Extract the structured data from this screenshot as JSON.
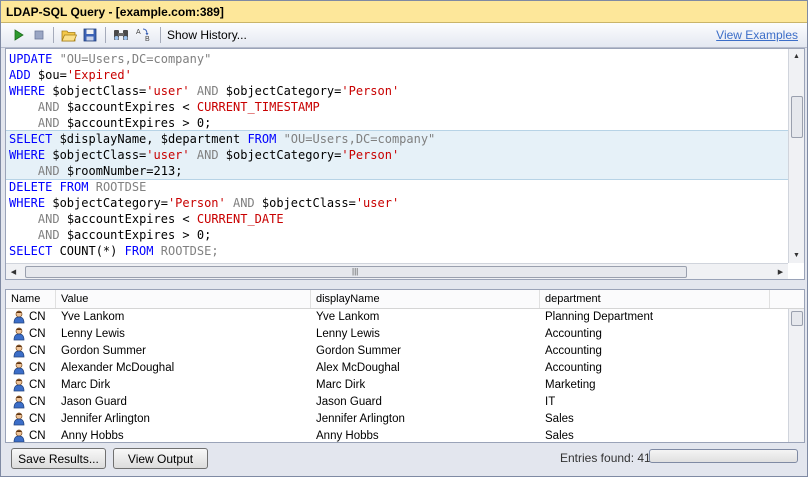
{
  "window": {
    "title": "LDAP-SQL Query - [example.com:389]"
  },
  "toolbar": {
    "icons": [
      "run-icon",
      "stop-icon",
      "open-folder-icon",
      "save-icon",
      "find-icon",
      "replace-icon"
    ],
    "show_history_label": "Show History...",
    "view_examples_label": "View Examples"
  },
  "editor": {
    "lines": [
      {
        "highlight": false,
        "tokens": [
          {
            "t": "kw",
            "v": "UPDATE"
          },
          {
            "t": "lit",
            "v": " \"OU=Users,DC=company\""
          }
        ]
      },
      {
        "highlight": false,
        "tokens": [
          {
            "t": "kw",
            "v": "ADD"
          },
          {
            "t": "plain",
            "v": " $ou="
          },
          {
            "t": "str",
            "v": "'Expired'"
          }
        ]
      },
      {
        "highlight": false,
        "tokens": [
          {
            "t": "kw",
            "v": "WHERE"
          },
          {
            "t": "plain",
            "v": " $objectClass="
          },
          {
            "t": "str",
            "v": "'user'"
          },
          {
            "t": "plain",
            "v": " "
          },
          {
            "t": "lit",
            "v": "AND"
          },
          {
            "t": "plain",
            "v": " $objectCategory="
          },
          {
            "t": "str",
            "v": "'Person'"
          }
        ]
      },
      {
        "highlight": false,
        "tokens": [
          {
            "t": "plain",
            "v": "    "
          },
          {
            "t": "lit",
            "v": "AND"
          },
          {
            "t": "plain",
            "v": " $accountExpires < "
          },
          {
            "t": "str",
            "v": "CURRENT_TIMESTAMP"
          }
        ]
      },
      {
        "highlight": false,
        "tokens": [
          {
            "t": "plain",
            "v": "    "
          },
          {
            "t": "lit",
            "v": "AND"
          },
          {
            "t": "plain",
            "v": " $accountExpires > 0;"
          }
        ]
      },
      {
        "highlight": true,
        "tokens": [
          {
            "t": "kw",
            "v": "SELECT"
          },
          {
            "t": "plain",
            "v": " $displayName, $department "
          },
          {
            "t": "kw",
            "v": "FROM"
          },
          {
            "t": "lit",
            "v": " \"OU=Users,DC=company\""
          }
        ]
      },
      {
        "highlight": true,
        "tokens": [
          {
            "t": "kw",
            "v": "WHERE"
          },
          {
            "t": "plain",
            "v": " $objectClass="
          },
          {
            "t": "str",
            "v": "'user'"
          },
          {
            "t": "plain",
            "v": " "
          },
          {
            "t": "lit",
            "v": "AND"
          },
          {
            "t": "plain",
            "v": " $objectCategory="
          },
          {
            "t": "str",
            "v": "'Person'"
          }
        ]
      },
      {
        "highlight": true,
        "tokens": [
          {
            "t": "plain",
            "v": "    "
          },
          {
            "t": "lit",
            "v": "AND"
          },
          {
            "t": "plain",
            "v": " $roomNumber=213;"
          }
        ]
      },
      {
        "highlight": false,
        "tokens": [
          {
            "t": "kw",
            "v": "DELETE"
          },
          {
            "t": "plain",
            "v": " "
          },
          {
            "t": "kw",
            "v": "FROM"
          },
          {
            "t": "lit",
            "v": " ROOTDSE"
          }
        ]
      },
      {
        "highlight": false,
        "tokens": [
          {
            "t": "kw",
            "v": "WHERE"
          },
          {
            "t": "plain",
            "v": " $objectCategory="
          },
          {
            "t": "str",
            "v": "'Person'"
          },
          {
            "t": "plain",
            "v": " "
          },
          {
            "t": "lit",
            "v": "AND"
          },
          {
            "t": "plain",
            "v": " $objectClass="
          },
          {
            "t": "str",
            "v": "'user'"
          }
        ]
      },
      {
        "highlight": false,
        "tokens": [
          {
            "t": "plain",
            "v": "    "
          },
          {
            "t": "lit",
            "v": "AND"
          },
          {
            "t": "plain",
            "v": " $accountExpires < "
          },
          {
            "t": "str",
            "v": "CURRENT_DATE"
          }
        ]
      },
      {
        "highlight": false,
        "tokens": [
          {
            "t": "plain",
            "v": "    "
          },
          {
            "t": "lit",
            "v": "AND"
          },
          {
            "t": "plain",
            "v": " $accountExpires > 0;"
          }
        ]
      },
      {
        "highlight": false,
        "tokens": [
          {
            "t": "kw",
            "v": "SELECT"
          },
          {
            "t": "plain",
            "v": " COUNT(*) "
          },
          {
            "t": "kw",
            "v": "FROM"
          },
          {
            "t": "lit",
            "v": " ROOTDSE;"
          }
        ]
      }
    ]
  },
  "results": {
    "columns": [
      "Name",
      "Value",
      "displayName",
      "department"
    ],
    "rows": [
      [
        "CN",
        "Yve Lankom",
        "Yve Lankom",
        "Planning Department"
      ],
      [
        "CN",
        "Lenny Lewis",
        "Lenny Lewis",
        "Accounting"
      ],
      [
        "CN",
        "Gordon Summer",
        "Gordon Summer",
        "Accounting"
      ],
      [
        "CN",
        "Alexander McDoughal",
        "Alex McDoughal",
        "Accounting"
      ],
      [
        "CN",
        "Marc Dirk",
        "Marc Dirk",
        "Marketing"
      ],
      [
        "CN",
        "Jason Guard",
        "Jason Guard",
        "IT"
      ],
      [
        "CN",
        "Jennifer Arlington",
        "Jennifer Arlington",
        "Sales"
      ],
      [
        "CN",
        "Anny Hobbs",
        "Anny Hobbs",
        "Sales"
      ]
    ]
  },
  "bottom": {
    "save_results_label": "Save Results...",
    "view_output_label": "View Output",
    "entries_label": "Entries found: 41"
  },
  "colors": {
    "title_bar": "#fde79a",
    "keyword": "#0000ff",
    "string": "#c80000",
    "literal": "#808080",
    "link": "#3c6ec8",
    "highlight": "#e6f1f8"
  }
}
